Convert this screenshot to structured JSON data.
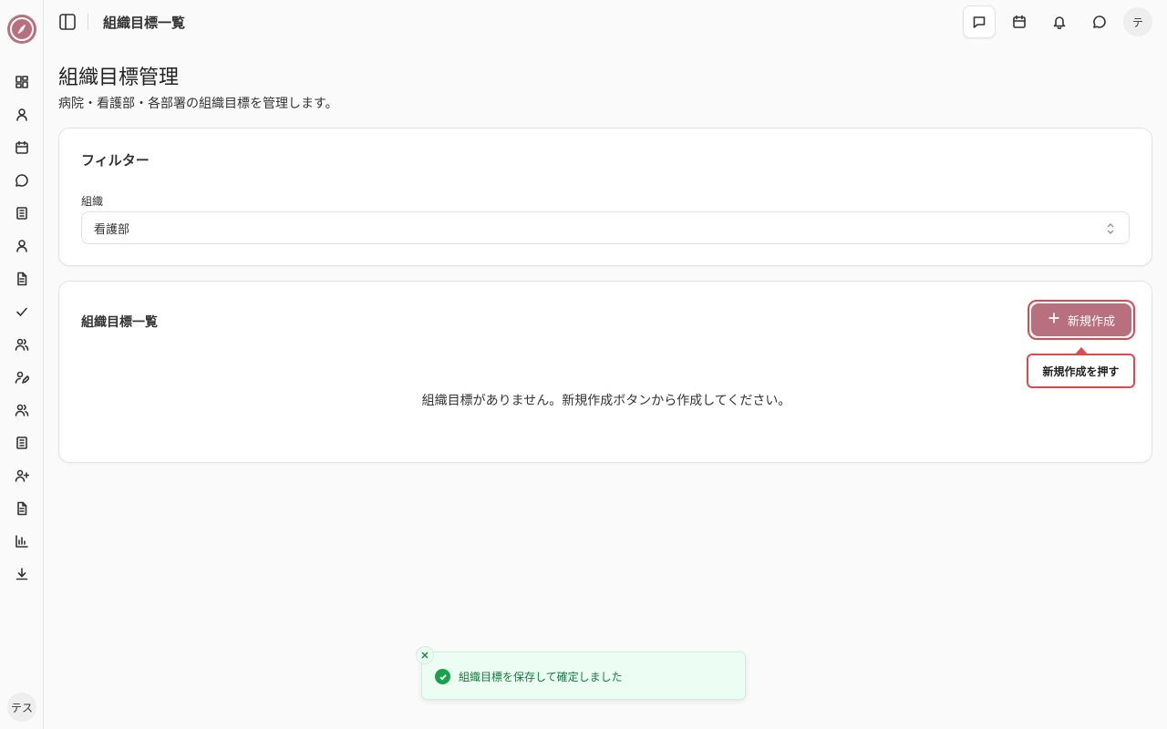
{
  "header": {
    "title": "組織目標一覧",
    "avatar": "テ"
  },
  "sidebar": {
    "avatar": "テス",
    "icons": [
      "dashboard-icon",
      "user-icon",
      "calendar-icon",
      "chat-icon",
      "book-icon",
      "user-icon",
      "file-icon",
      "check-icon",
      "users-icon",
      "user-edit-icon",
      "users-icon",
      "book-icon",
      "user-plus-icon",
      "file-icon",
      "chart-icon",
      "download-icon"
    ]
  },
  "page": {
    "title": "組織目標管理",
    "subtitle": "病院・看護部・各部署の組織目標を管理します。"
  },
  "filter": {
    "title": "フィルター",
    "label": "組織",
    "selected": "看護部"
  },
  "list": {
    "title": "組織目標一覧",
    "new_button": "新規作成",
    "tooltip": "新規作成を押す",
    "empty": "組織目標がありません。新規作成ボタンから作成してください。"
  },
  "toast": {
    "message": "組織目標を保存して確定しました"
  },
  "colors": {
    "accent": "#b8707e",
    "highlight": "#e04850",
    "success": "#16a34a"
  }
}
